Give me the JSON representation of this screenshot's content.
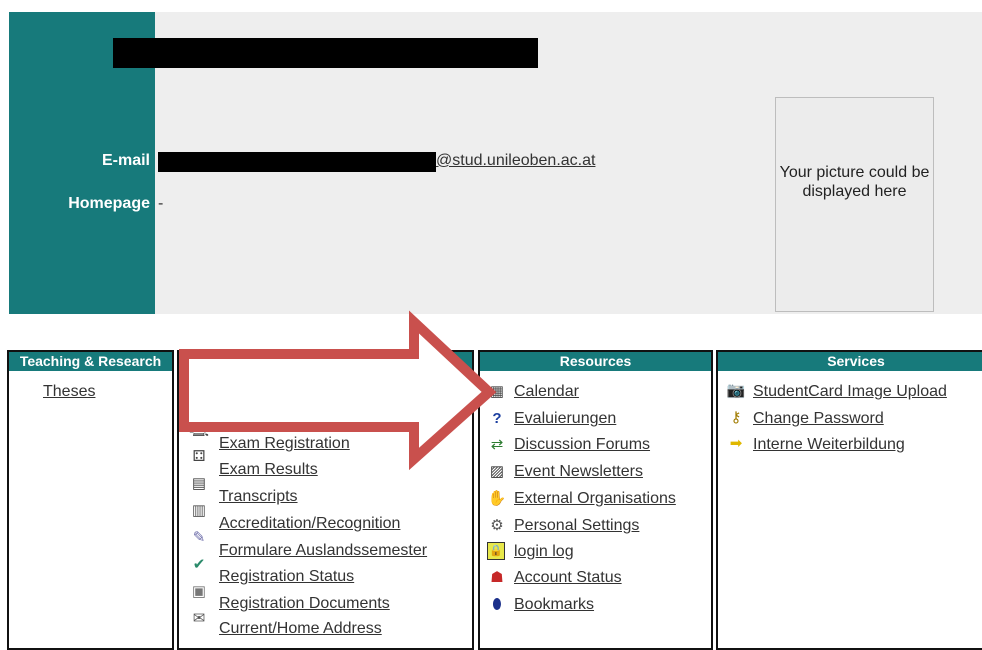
{
  "profile": {
    "email_label": "E-mail",
    "email_domain": "@stud.unileoben.ac.at",
    "homepage_label": "Homepage",
    "homepage_value": "-",
    "picture_placeholder": "Your picture could be displayed here"
  },
  "panels": {
    "teaching": {
      "title": "Teaching & Research",
      "items": [
        "Theses"
      ]
    },
    "studies": {
      "items": [
        "Exam Registration",
        "Exam Results",
        "Transcripts",
        "Accreditation/Recognition",
        "Formulare Auslandssemester",
        "Registration Status",
        "Registration Documents",
        "Current/Home Address"
      ]
    },
    "resources": {
      "title": "Resources",
      "items": [
        "Calendar",
        "Evaluierungen",
        "Discussion Forums",
        "Event Newsletters",
        "External Organisations",
        "Personal Settings",
        "login log",
        "Account Status",
        "Bookmarks"
      ]
    },
    "services": {
      "title": "Services",
      "items": [
        "StudentCard Image Upload",
        "Change Password",
        "Interne Weiterbildung"
      ]
    }
  },
  "colors": {
    "teal": "#177a7b",
    "arrow_red": "#c9504d"
  }
}
